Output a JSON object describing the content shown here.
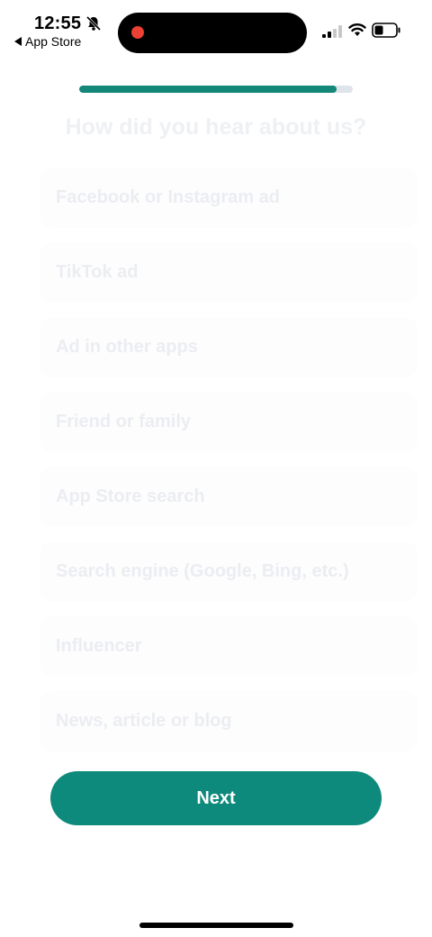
{
  "status_bar": {
    "time": "12:55",
    "back_label": "App Store"
  },
  "progress": {
    "fraction": 0.94,
    "color": "#13877a",
    "track_color": "#dfe3ea"
  },
  "question": {
    "title": "How did you hear about us?"
  },
  "options": [
    {
      "label": "Facebook or Instagram ad"
    },
    {
      "label": "TikTok ad"
    },
    {
      "label": "Ad in other apps"
    },
    {
      "label": "Friend or family"
    },
    {
      "label": "App Store search"
    },
    {
      "label": "Search engine (Google, Bing, etc.)"
    },
    {
      "label": "Influencer"
    },
    {
      "label": "News, article or blog"
    }
  ],
  "next_button": {
    "label": "Next",
    "color": "#0e8a7c"
  },
  "icons": {
    "bell": "bell-slash-icon",
    "signal": "cellular-signal-icon",
    "wifi": "wifi-icon",
    "battery": "battery-icon",
    "record": "screen-recording-icon"
  }
}
